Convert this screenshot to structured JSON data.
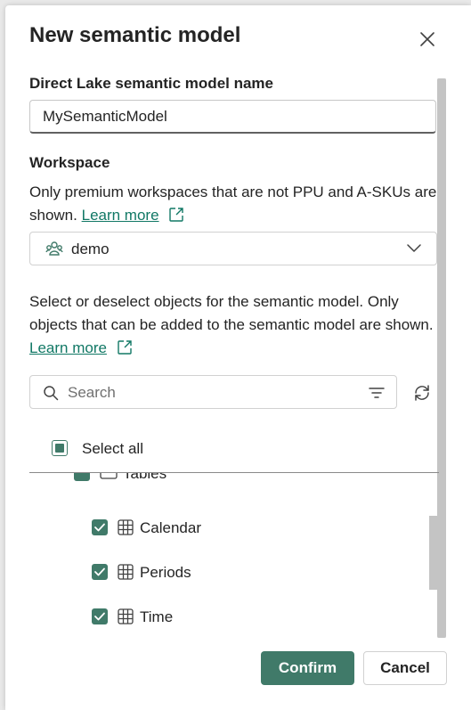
{
  "dialog": {
    "title": "New semantic model",
    "close_icon": "close-icon"
  },
  "name_field": {
    "label": "Direct Lake semantic model name",
    "value": "MySemanticModel"
  },
  "workspace": {
    "label": "Workspace",
    "description": "Only premium workspaces that are not PPU and A-SKUs are shown.",
    "learn_more": "Learn more",
    "selected": "demo",
    "icon": "workspace-icon"
  },
  "objects": {
    "description": "Select or deselect objects for the semantic model. Only objects that can be added to the semantic model are shown.",
    "learn_more": "Learn more",
    "search_placeholder": "Search",
    "select_all_label": "Select all",
    "group_label": "Tables",
    "tables": [
      {
        "name": "Calendar",
        "checked": true
      },
      {
        "name": "Periods",
        "checked": true
      },
      {
        "name": "Time",
        "checked": true
      }
    ]
  },
  "buttons": {
    "confirm": "Confirm",
    "cancel": "Cancel"
  },
  "colors": {
    "accent": "#407a69",
    "link": "#117865"
  }
}
